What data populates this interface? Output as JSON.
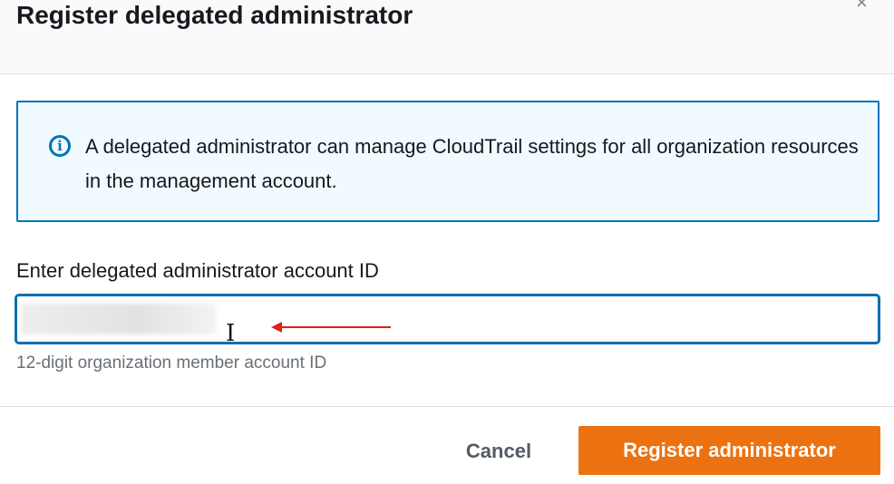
{
  "dialog": {
    "title": "Register delegated administrator",
    "close_icon": "×",
    "info": {
      "icon": "i",
      "text": "A delegated administrator can manage CloudTrail settings for all organization resources in the management account."
    },
    "field": {
      "label": "Enter delegated administrator account ID",
      "value": "",
      "hint": "12-digit organization member account ID"
    },
    "buttons": {
      "cancel": "Cancel",
      "register": "Register administrator"
    },
    "colors": {
      "primary": "#ec7211",
      "info_border": "#0073bb"
    }
  }
}
